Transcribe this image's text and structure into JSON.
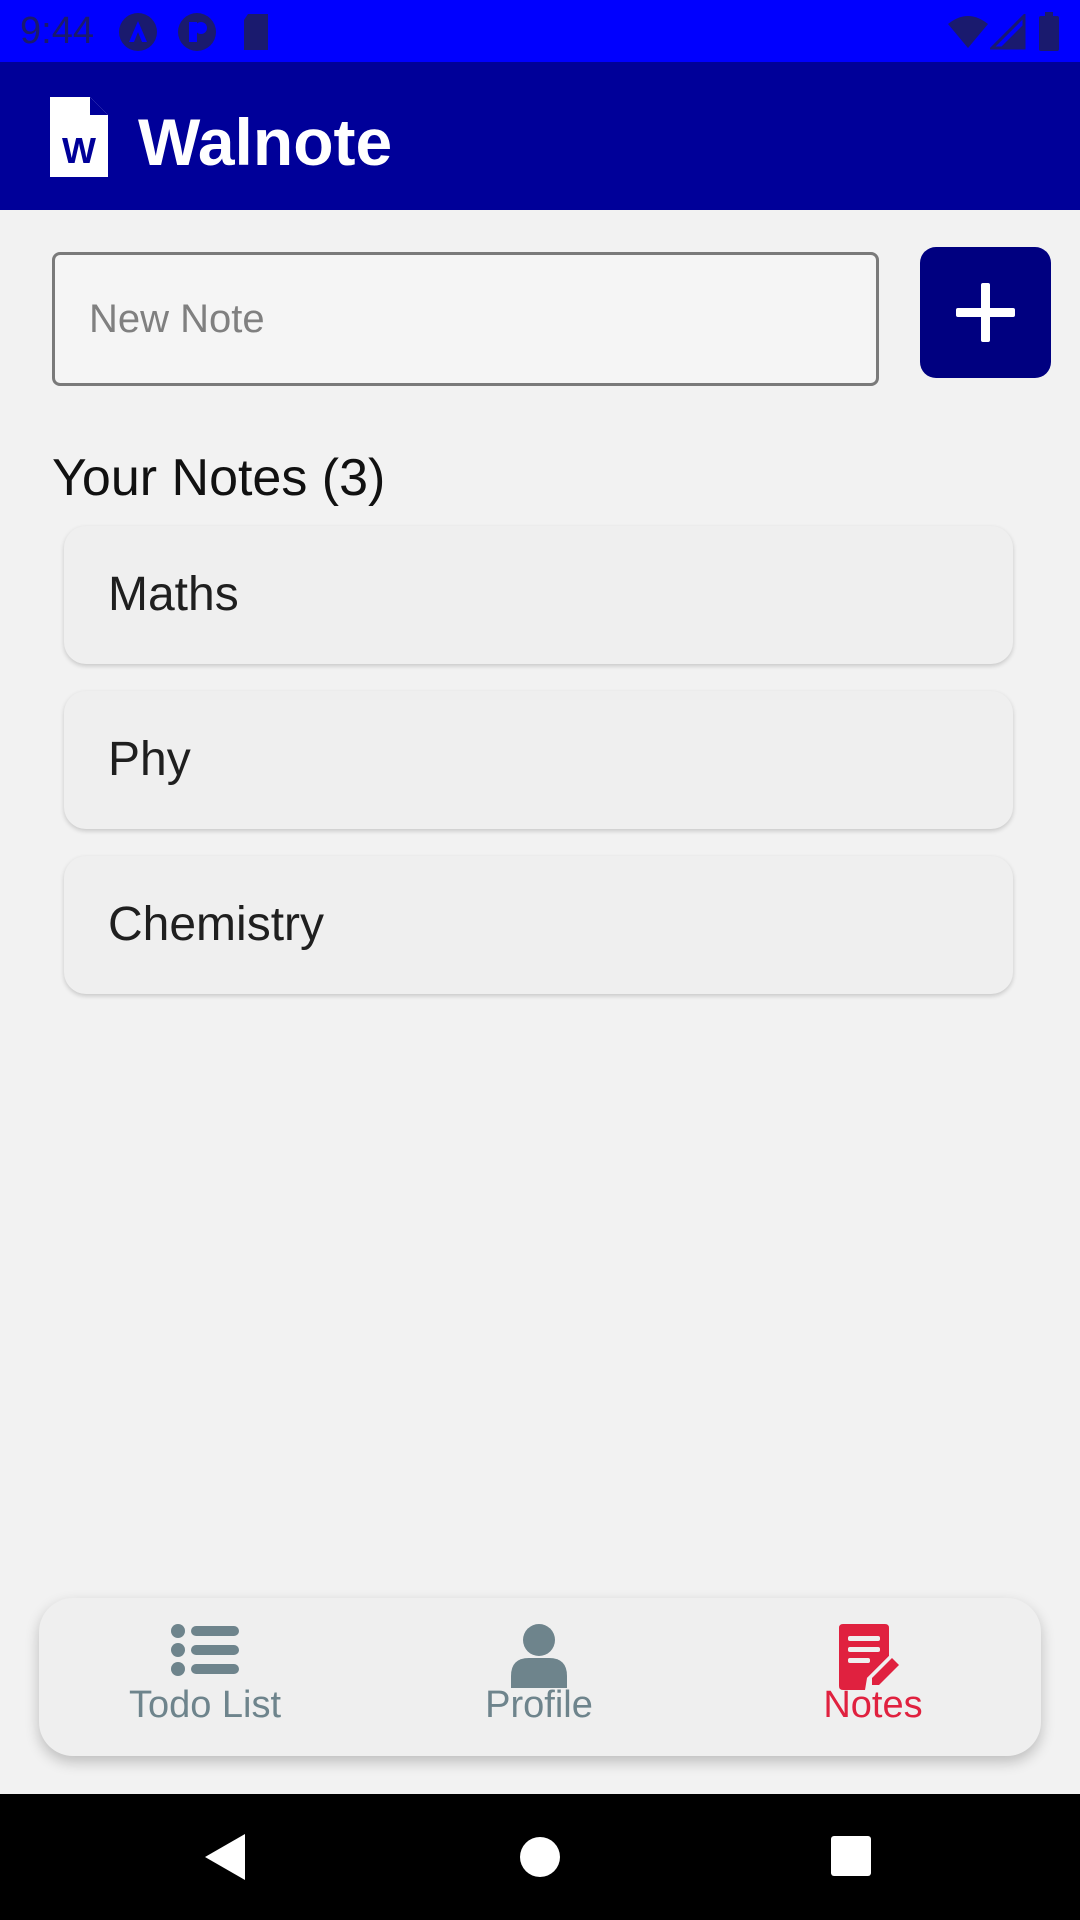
{
  "status_bar": {
    "time": "9:44",
    "background_color": "#0000ff",
    "left_icons": [
      "android-auto-icon",
      "app-badge-icon",
      "sd-card-icon"
    ],
    "right_icons": [
      "wifi-icon",
      "cellular-signal-icon",
      "battery-icon"
    ]
  },
  "app_bar": {
    "title": "Walnote",
    "logo_letter": "W",
    "background_color": "#000099"
  },
  "new_note": {
    "placeholder": "New Note",
    "value": "",
    "add_button_icon": "plus-icon",
    "add_button_color": "#000080"
  },
  "notes_section": {
    "heading": "Your Notes (3)",
    "items": [
      {
        "label": "Maths"
      },
      {
        "label": "Phy"
      },
      {
        "label": "Chemistry"
      }
    ]
  },
  "bottom_nav": {
    "active_color": "#e0213f",
    "inactive_color": "#6e848c",
    "items": [
      {
        "label": "Todo List",
        "icon": "list-icon",
        "active": false
      },
      {
        "label": "Profile",
        "icon": "user-icon",
        "active": false
      },
      {
        "label": "Notes",
        "icon": "note-edit-icon",
        "active": true
      }
    ]
  },
  "system_nav": {
    "buttons": [
      "back-icon",
      "home-icon",
      "recents-icon"
    ]
  }
}
